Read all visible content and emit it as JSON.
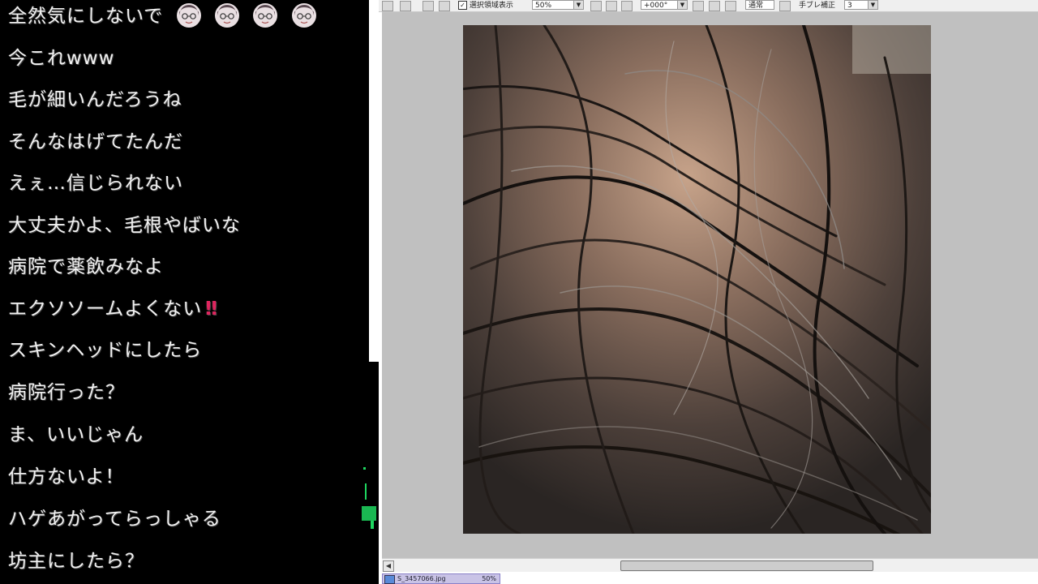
{
  "chat": {
    "messages": [
      "全然気にしないで",
      "今これwww",
      "毛が細いんだろうね",
      "そんなはげてたんだ",
      "えぇ…信じられない",
      "大丈夫かよ、毛根やばいな",
      "病院で薬飲みなよ",
      "エクソソームよくない",
      "スキンヘッドにしたら",
      "病院行った？",
      "ま、いいじゃん",
      "仕方ないよ！",
      "ハゲあがってらっしゃる",
      "坊主にしたら？"
    ],
    "exclamation_mark": "‼"
  },
  "toolbar": {
    "selection_display_label": "選択領域表示",
    "zoom_value": "50%",
    "rotation_value": "+000°",
    "blend_mode": "通常",
    "stabilizer_label": "手ブレ補正",
    "stabilizer_value": "3"
  },
  "status": {
    "file_name": "S_3457066.jpg",
    "file_zoom": "50%"
  },
  "colors": {
    "accent_green": "#1ed760",
    "file_tab_bg": "#c9c3e6"
  }
}
